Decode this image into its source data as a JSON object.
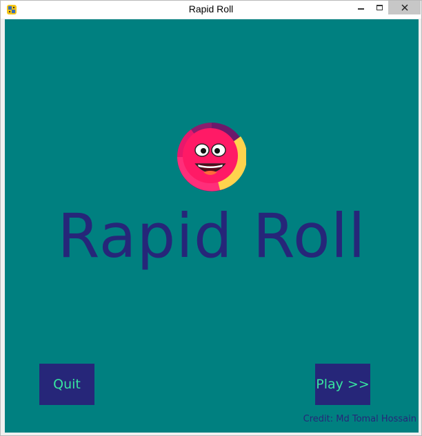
{
  "window": {
    "title": "Rapid Roll",
    "icon": "python-icon"
  },
  "controls": {
    "minimize_icon": "minimize-icon",
    "maximize_icon": "maximize-icon",
    "close_icon": "close-icon"
  },
  "game": {
    "background_color": "#008080",
    "logo_icon": "smiling-ball-icon",
    "title": "Rapid Roll",
    "title_color": "#262679",
    "quit_label": "Quit",
    "play_label": "Play >>",
    "button_color": "#262679",
    "button_text_color": "#37e6a0",
    "credit": "Credit: Md Tomal Hossain"
  }
}
